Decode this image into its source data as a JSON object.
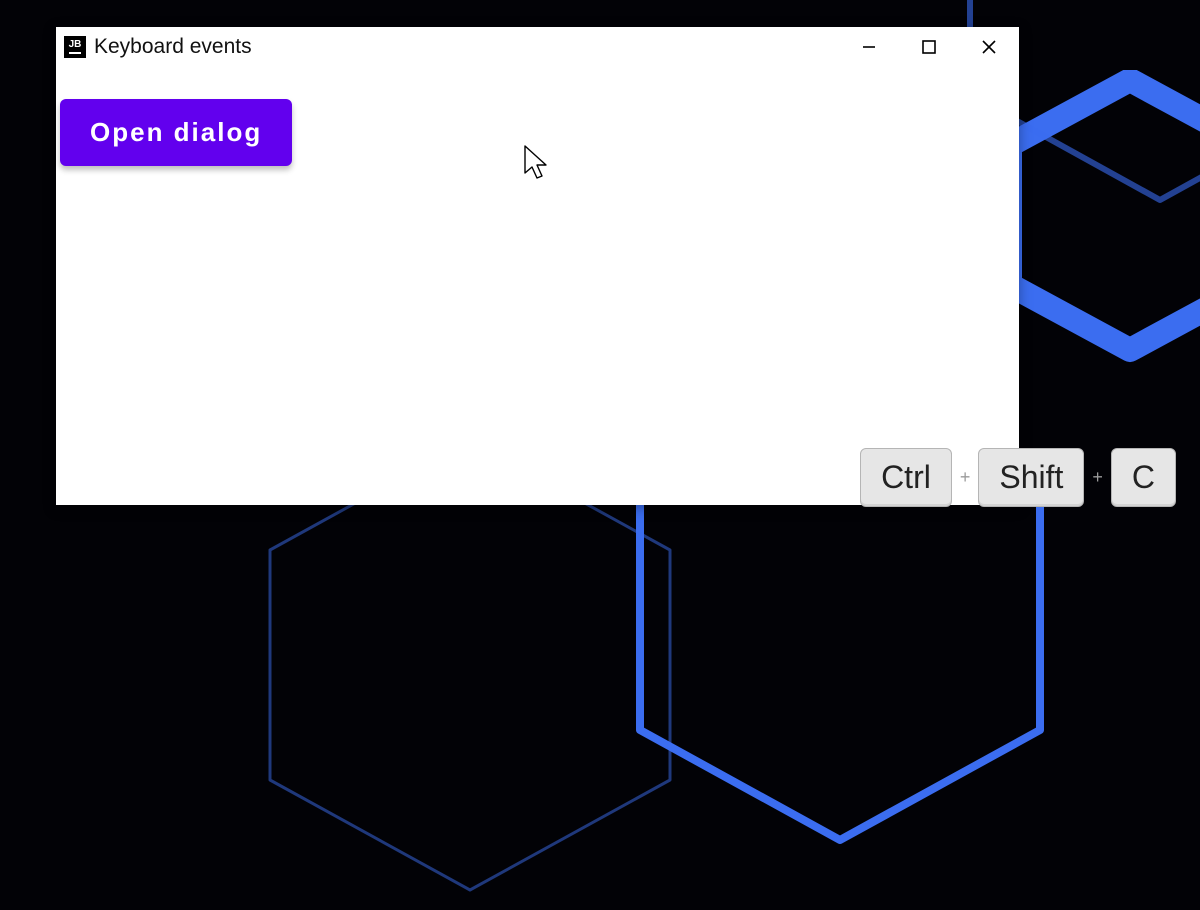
{
  "window": {
    "title": "Keyboard events",
    "app_icon_text": "JB",
    "buttons": {
      "open_dialog": "Open dialog"
    }
  },
  "key_overlay": {
    "keys": [
      "Ctrl",
      "Shift",
      "C"
    ],
    "separator": "+"
  },
  "colors": {
    "accent": "#6200ee",
    "hex_blue": "#3b6df0"
  }
}
